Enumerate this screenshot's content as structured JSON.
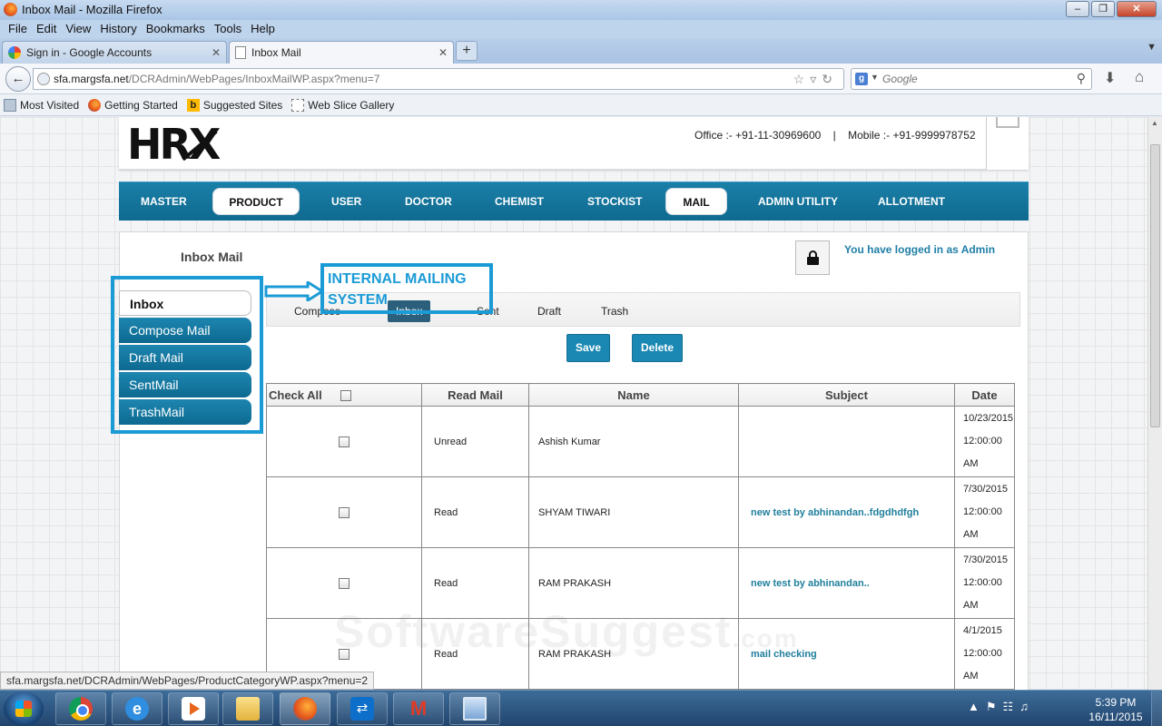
{
  "browser": {
    "window_title": "Inbox Mail - Mozilla Firefox",
    "menu": [
      "File",
      "Edit",
      "View",
      "History",
      "Bookmarks",
      "Tools",
      "Help"
    ],
    "tabs": [
      {
        "label": "Sign in - Google Accounts"
      },
      {
        "label": "Inbox Mail"
      }
    ],
    "url_domain": "sfa.margsfa.net",
    "url_path": "/DCRAdmin/WebPages/InboxMailWP.aspx?menu=7",
    "search_placeholder": "Google",
    "bookmarks": [
      "Most Visited",
      "Getting Started",
      "Suggested Sites",
      "Web Slice Gallery"
    ],
    "status_url": "sfa.margsfa.net/DCRAdmin/WebPages/ProductCategoryWP.aspx?menu=2"
  },
  "header": {
    "logo": "HRX",
    "contact": "Office :- +91-11-30969600    |    Mobile :- +91-9999978752"
  },
  "nav": {
    "items": [
      "MASTER",
      "PRODUCT",
      "USER",
      "DOCTOR",
      "CHEMIST",
      "STOCKIST",
      "MAIL",
      "ADMIN UTILITY",
      "ALLOTMENT"
    ]
  },
  "page": {
    "title": "Inbox Mail",
    "login_text": "You have logged in as Admin"
  },
  "sidebar": {
    "items": [
      "Inbox",
      "Compose Mail",
      "Draft Mail",
      "SentMail",
      "TrashMail"
    ]
  },
  "mail_tabs": [
    "Compose",
    "Inbox",
    "Sent",
    "Draft",
    "Trash"
  ],
  "actions": {
    "save": "Save",
    "delete": "Delete"
  },
  "table": {
    "headers": [
      "Check All",
      "Read Mail",
      "Name",
      "Subject",
      "Date"
    ],
    "rows": [
      {
        "read": "Unread",
        "name": "Ashish Kumar",
        "subject": "",
        "date": "10/23/2015",
        "time": "12:00:00",
        "ampm": "AM"
      },
      {
        "read": "Read",
        "name": "SHYAM TIWARI",
        "subject": "new test by abhinandan..fdgdhdfgh",
        "date": "7/30/2015",
        "time": "12:00:00",
        "ampm": "AM"
      },
      {
        "read": "Read",
        "name": "RAM PRAKASH",
        "subject": "new test by abhinandan..",
        "date": "7/30/2015",
        "time": "12:00:00",
        "ampm": "AM"
      },
      {
        "read": "Read",
        "name": "RAM PRAKASH",
        "subject": "mail checking",
        "date": "4/1/2015",
        "time": "12:00:00",
        "ampm": "AM"
      }
    ]
  },
  "annotation": {
    "label": "INTERNAL MAILING SYSTEM",
    "color": "#1b9bd6"
  },
  "watermark": {
    "main": "SoftwareSuggest",
    "suffix": ".com"
  },
  "taskbar": {
    "apps": [
      "chrome-icon",
      "internet-explorer-icon",
      "media-player-icon",
      "file-explorer-icon",
      "firefox-icon",
      "teamviewer-icon",
      "marg-icon",
      "screen-icon"
    ],
    "time": "5:39 PM",
    "date": "16/11/2015"
  },
  "colors": {
    "accent": "#1b88b3",
    "nav": "#0f6a8f",
    "subject_link": "#1f7f9c"
  }
}
